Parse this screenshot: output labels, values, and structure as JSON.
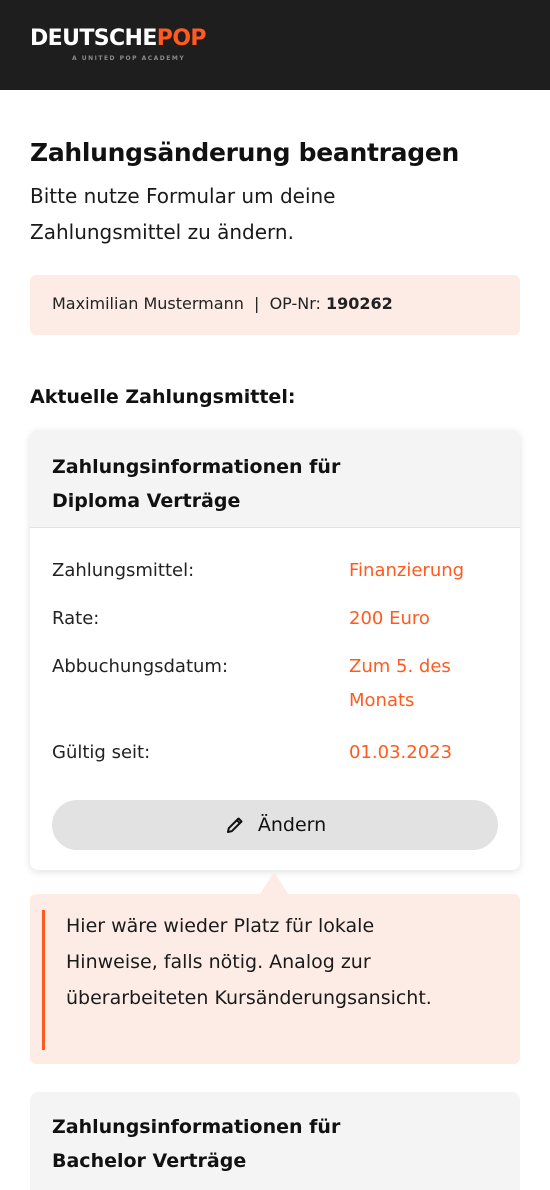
{
  "header": {
    "logo_part1": "DEUTSCHE",
    "logo_part2": "POP",
    "logo_tagline": "A UNITED POP ACADEMY",
    "accent_color": "#ff5a1f",
    "background_color": "#1e1e1e"
  },
  "page": {
    "title": "Zahlungsänderung beantragen",
    "intro": "Bitte nutze Formular um deine Zahlungsmittel zu ändern."
  },
  "user_info": {
    "name_segment": "Maximilian Mustermann  |  OP-Nr: ",
    "op_number": "190262"
  },
  "current_section": {
    "heading": "Aktuelle Zahlungsmittel:"
  },
  "diploma_card": {
    "title": "Zahlungsinformationen für Diploma Verträge",
    "rows": [
      {
        "label": "Zahlungsmittel:",
        "value": "Finanzierung"
      },
      {
        "label": "Rate:",
        "value": "200 Euro"
      },
      {
        "label": "Abbuchungsdatum:",
        "value": "Zum 5. des Monats"
      },
      {
        "label": "Gültig seit:",
        "value": "01.03.2023"
      }
    ],
    "edit_button_label": "Ändern",
    "edit_icon": "pencil-icon"
  },
  "notice": {
    "text": "Hier wäre wieder Platz für lokale Hinweise, falls nötig. Analog zur überarbeiteten Kursänderungsansicht."
  },
  "bachelor_card": {
    "title": "Zahlungsinformationen für Bachelor Verträge"
  }
}
